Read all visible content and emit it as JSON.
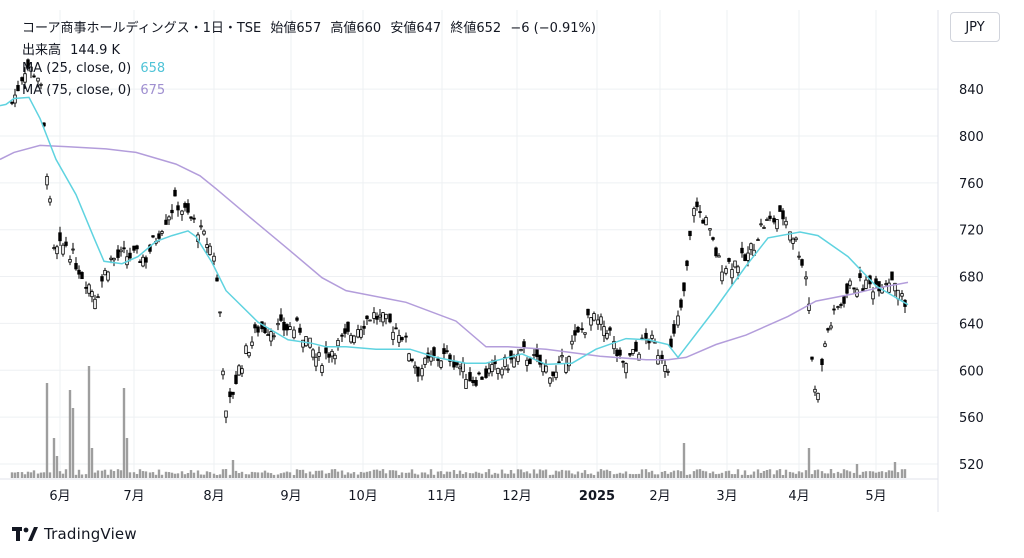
{
  "header": {
    "title": "コーア商事ホールディングス・1日・TSE",
    "open_label": "始値",
    "open": "657",
    "high_label": "高値",
    "high": "660",
    "low_label": "安値",
    "low": "647",
    "close_label": "終値",
    "close": "652",
    "change": "−6 (−0.91%)",
    "volume_label": "出来高",
    "volume": "144.9 K",
    "ma25_label": "MA (25, close, 0)",
    "ma25_value": "658",
    "ma75_label": "MA (75, close, 0)",
    "ma75_value": "675"
  },
  "currency_button": "JPY",
  "brand": "TradingView",
  "colors": {
    "up": "#ffffff",
    "down": "#000000",
    "ma25": "#5fd3e0",
    "ma75": "#b39ddb",
    "volume": "#9e9e9e",
    "grid": "#eef0f3",
    "axis_text": "#131722"
  },
  "chart_data": {
    "type": "candlestick",
    "y_axis": {
      "range": [
        508,
        876
      ],
      "ticks": [
        "840",
        "800",
        "760",
        "720",
        "680",
        "640",
        "600",
        "560",
        "520"
      ]
    },
    "x_axis_labels": [
      "6月",
      "7月",
      "8月",
      "9月",
      "10月",
      "11月",
      "12月",
      "2025",
      "2月",
      "3月",
      "4月",
      "5月"
    ],
    "grid": true,
    "series": [
      {
        "name": "MA (25, close, 0)",
        "x": [
          0,
          6,
          14,
          29,
          40,
          56,
          76,
          94,
          104,
          122,
          138,
          156,
          172,
          188,
          196,
          212,
          226,
          258,
          288,
          312,
          326,
          346,
          376,
          410,
          436,
          466,
          486,
          522,
          546,
          572,
          596,
          626,
          648,
          668,
          678,
          714,
          746,
          768,
          800,
          818,
          848,
          876,
          908
        ],
        "y": [
          826,
          827,
          832,
          833,
          815,
          780,
          750,
          713,
          693,
          691,
          697,
          710,
          715,
          719,
          714,
          692,
          668,
          641,
          626,
          623,
          620,
          620,
          618,
          618,
          611,
          606,
          606,
          614,
          605,
          606,
          618,
          627,
          626,
          622,
          611,
          651,
          689,
          713,
          718,
          715,
          697,
          672,
          656
        ]
      },
      {
        "name": "MA (75, close, 0)",
        "x": [
          0,
          14,
          40,
          66,
          106,
          136,
          176,
          200,
          216,
          248,
          286,
          322,
          346,
          406,
          456,
          486,
          508,
          546,
          600,
          646,
          668,
          686,
          716,
          746,
          788,
          816,
          852,
          876,
          908
        ],
        "y": [
          780,
          786,
          792,
          791,
          789,
          786,
          776,
          766,
          755,
          732,
          705,
          679,
          668,
          658,
          642,
          620,
          620,
          618,
          612,
          609,
          609,
          611,
          622,
          630,
          646,
          659,
          665,
          670,
          675
        ]
      },
      {
        "name": "出来高",
        "type": "volume",
        "description": "daily volume bars, tallest spikes near 6月 and 8月"
      }
    ],
    "last": {
      "open": 657,
      "high": 660,
      "low": 647,
      "close": 652,
      "change": -6,
      "change_pct": -0.91,
      "volume": "144.9 K"
    },
    "recent_volume_k": 144.9
  }
}
